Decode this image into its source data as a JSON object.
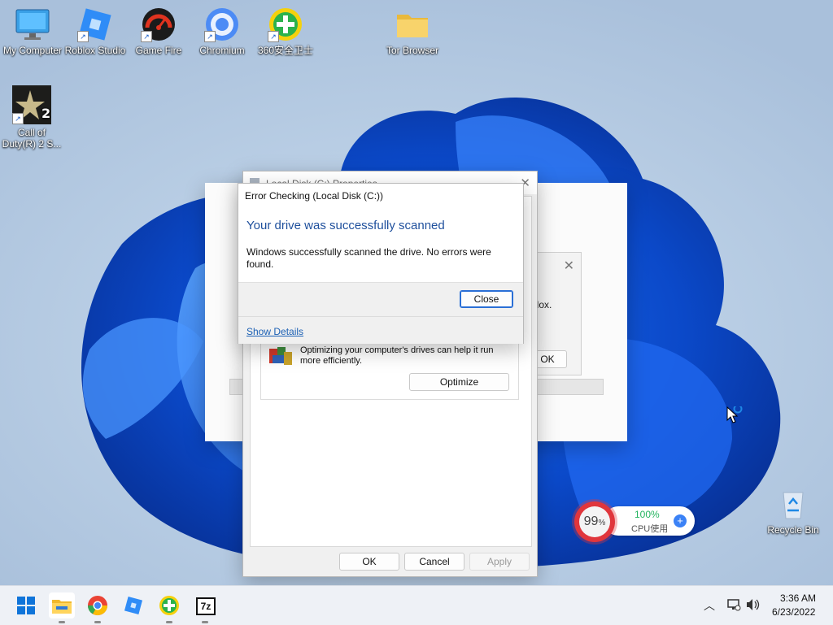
{
  "desktop_icons": [
    {
      "label": "My Computer",
      "icon": "monitor-icon"
    },
    {
      "label": "Roblox Studio",
      "icon": "roblox-studio-icon"
    },
    {
      "label": "Game Fire",
      "icon": "game-fire-icon"
    },
    {
      "label": "Chromium",
      "icon": "chromium-icon"
    },
    {
      "label": "360安全卫士",
      "icon": "360-security-icon"
    },
    {
      "label": "Tor Browser",
      "icon": "folder-icon"
    },
    {
      "label": "Call of Duty(R) 2 S...",
      "icon": "call-of-duty-icon"
    },
    {
      "label": "Recycle Bin",
      "icon": "recycle-bin-icon"
    }
  ],
  "properties_window": {
    "title": "Local Disk (C:) Properties",
    "optimize_text": "Optimizing your computer's drives can help it run more efficiently.",
    "optimize_button": "Optimize",
    "ok_button": "OK",
    "cancel_button": "Cancel",
    "apply_button": "Apply"
  },
  "background_dialog": {
    "partial_text": "blox.",
    "ok_button": "OK"
  },
  "error_dialog": {
    "title": "Error Checking (Local Disk (C:))",
    "heading": "Your drive was successfully scanned",
    "message": "Windows successfully scanned the drive. No errors were found.",
    "close_button": "Close",
    "details_link": "Show Details"
  },
  "cpu_widget": {
    "memory_percent": "99",
    "percent_sign": "%",
    "cpu_value": "100%",
    "cpu_label": "CPU使用",
    "accent": "#e0363c",
    "cpu_color": "#22b35e"
  },
  "taskbar": {
    "apps": [
      "start-icon",
      "file-explorer-icon",
      "chromium-icon",
      "roblox-studio-icon",
      "360-security-icon",
      "7zip-icon"
    ],
    "seven_zip_label": "7z",
    "time": "3:36 AM",
    "date": "6/23/2022"
  }
}
